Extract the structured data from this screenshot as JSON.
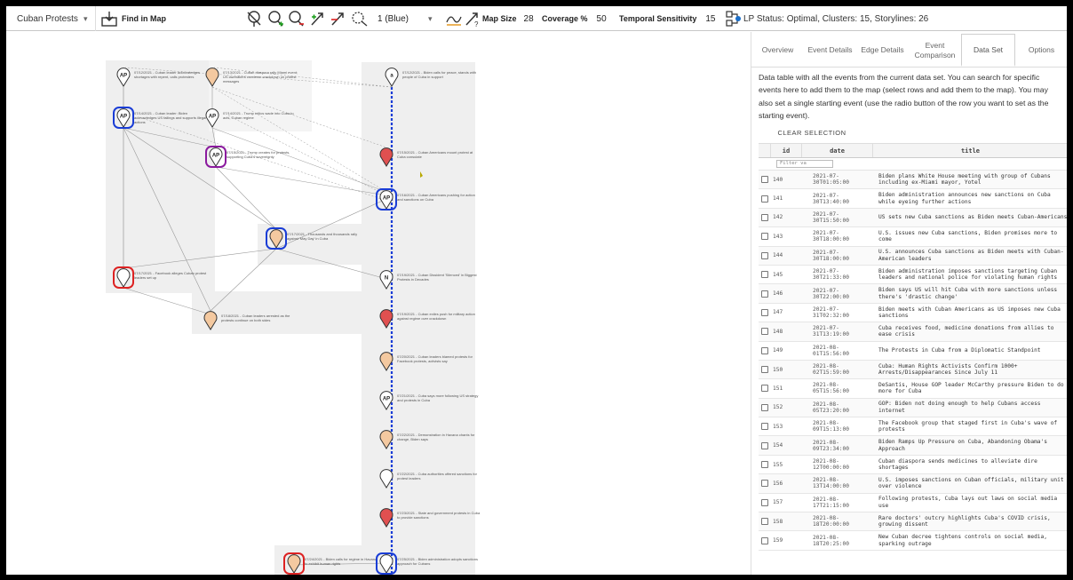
{
  "toolbar": {
    "dataset": "Cuban Protests",
    "find_in_map": "Find in Map",
    "timeline_select": "1 (Blue)",
    "map_size_label": "Map Size",
    "map_size": "28",
    "coverage_label": "Coverage %",
    "coverage": "50",
    "temporal_label": "Temporal Sensitivity",
    "temporal": "15",
    "status": "LP Status: Optimal, Clusters: 15, Storylines: 26",
    "icons": [
      "drop-down-icon",
      "find-in-map-icon",
      "no-pin-icon",
      "add-pin-icon",
      "remove-pin-icon",
      "add-edge-icon",
      "remove-edge-icon",
      "split-icon",
      "chevron-down-icon",
      "storyline-icon",
      "question-edge-icon",
      "filter-icon"
    ]
  },
  "panel": {
    "tabs": [
      {
        "label": "Overview"
      },
      {
        "label": "Event Details"
      },
      {
        "label": "Edge Details"
      },
      {
        "label": "Event Comparison"
      },
      {
        "label": "Data Set"
      },
      {
        "label": "Options"
      }
    ],
    "active_tab": "Data Set",
    "description": "Data table with all the events from the current data set. You can search for specific events here to add them to the map (select rows and add them to the map). You may also set a single starting event (use the radio button of the row you want to set as the starting event).",
    "clear_selection": "CLEAR SELECTION",
    "columns": {
      "id": "id",
      "date": "date",
      "title": "title"
    },
    "filter_placeholder": "Filter va",
    "rows": [
      {
        "id": "140",
        "date": "2021-07-30T01:05:00",
        "title": "Biden plans White House meeting with group of Cubans including ex-Miami mayor, Yotel"
      },
      {
        "id": "141",
        "date": "2021-07-30T13:40:00",
        "title": "Biden administration announces new sanctions on Cuba while eyeing further actions"
      },
      {
        "id": "142",
        "date": "2021-07-30T15:50:00",
        "title": "US sets new Cuba sanctions as Biden meets Cuban-Americans"
      },
      {
        "id": "143",
        "date": "2021-07-30T18:00:00",
        "title": "U.S. issues new Cuba sanctions, Biden promises more to come"
      },
      {
        "id": "144",
        "date": "2021-07-30T18:00:00",
        "title": "U.S. announces Cuba sanctions as Biden meets with Cuban-American leaders"
      },
      {
        "id": "145",
        "date": "2021-07-30T21:33:00",
        "title": "Biden administration imposes sanctions targeting Cuban leaders and national police for violating human rights"
      },
      {
        "id": "146",
        "date": "2021-07-30T22:00:00",
        "title": "Biden says US will hit Cuba with more sanctions unless there's 'drastic change'"
      },
      {
        "id": "147",
        "date": "2021-07-31T02:32:00",
        "title": "Biden meets with Cuban Americans as US imposes new Cuba sanctions"
      },
      {
        "id": "148",
        "date": "2021-07-31T13:19:00",
        "title": "Cuba receives food, medicine donations from allies to ease crisis"
      },
      {
        "id": "149",
        "date": "2021-08-01T15:56:00",
        "title": "The Protests in Cuba from a Diplomatic Standpoint"
      },
      {
        "id": "150",
        "date": "2021-08-02T15:59:00",
        "title": "Cuba: Human Rights Activists Confirm 1000+ Arrests/Disappearances Since July 11"
      },
      {
        "id": "151",
        "date": "2021-08-05T15:56:00",
        "title": "DeSantis, House GOP leader McCarthy pressure Biden to do more for Cuba"
      },
      {
        "id": "152",
        "date": "2021-08-05T23:20:00",
        "title": "GOP: Biden not doing enough to help Cubans access internet"
      },
      {
        "id": "153",
        "date": "2021-08-09T15:13:00",
        "title": "The Facebook group that staged first in Cuba's wave of protests"
      },
      {
        "id": "154",
        "date": "2021-08-09T23:34:00",
        "title": "Biden Ramps Up Pressure on Cuba, Abandoning Obama's Approach"
      },
      {
        "id": "155",
        "date": "2021-08-12T00:00:00",
        "title": "Cuban diaspora sends medicines to alleviate dire shortages"
      },
      {
        "id": "156",
        "date": "2021-08-13T14:00:00",
        "title": "U.S. imposes sanctions on Cuban officials, military unit over violence"
      },
      {
        "id": "157",
        "date": "2021-08-17T21:15:00",
        "title": "Following protests, Cuba lays out laws on social media use"
      },
      {
        "id": "158",
        "date": "2021-08-18T20:00:00",
        "title": "Rare doctors' outcry highlights Cuba's COVID crisis, growing dissent"
      },
      {
        "id": "159",
        "date": "2021-08-18T20:25:00",
        "title": "New Cuban decree tightens controls on social media, sparking outrage"
      }
    ]
  },
  "map": {
    "node_labels": [
      "07/12/2021 - Cuban leader acknowledges shortages with repent, calls protesters",
      "07/13/2021 - Cuban diaspora rally Miami event; US lawmakers condemn crackdown on protest messages",
      "07/12/2021 - Biden calls for peace, stands with people of Cuba in support",
      "07/14/2021 - Cuban leader: Biden acknowledges US failings and supports illegal actions",
      "07/14/2021 - Trump critics wade into Cuba to acts, Cuban regime",
      "07/15/2021 - Trump creates for protests, supporting Cuba's sovereignty",
      "07/15/2021 - Cuban Americans mount protest at Cuba consulate",
      "07/16/2021 - Cuban Americans pushing for action and sanctions on Cuba",
      "07/17/2021 - Facebook alleges Cuban protest leaders set up",
      "07/17/2021 - Thousands and thousands rally against 'May Day' in Cuba",
      "07/18/2021 - Cuban leaders arrested as the protests continue on both sides",
      "07/19/2021 - Cuban Dissident 'Silenced' in Biggest Protests in Decades",
      "07/19/2021 - Cuban exiles push for military action against regime over crackdown",
      "07/20/2021 - Cuban leaders blamed protests for Facebook protests, activists say",
      "07/21/2021 - Cuba says more following US strategy and protests in Cuba",
      "07/22/2021 - Demonstration in Havana chants for change, Biden says",
      "07/22/2021 - Cuba authorities offered sanctions for protest leaders",
      "07/23/2021 - State and government protests in Cuba to provide sanctions",
      "07/24/2021 - Biden calls for regime in Havana to exhibit human rights",
      "07/25/2021 - Biden administration adopts sanctions approach for Cubans",
      "07/26/2021 - Cuban president warns of US-backed 'subversion' campaign"
    ]
  }
}
